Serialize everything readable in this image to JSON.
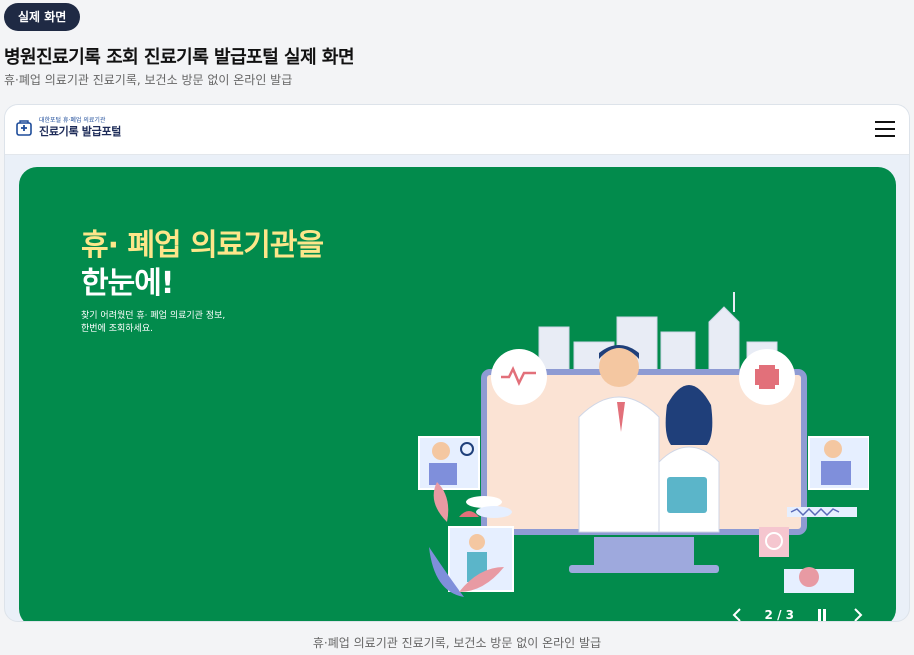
{
  "badge": "실제 화면",
  "title": "병원진료기록 조회 진료기록 발급포털 실제 화면",
  "subtitle": "휴·폐업 의료기관 진료기록, 보건소 방문 없이 온라인 발급",
  "site": {
    "logo_small": "대한포털 휴·폐업 의료기관",
    "logo_big": "진료기록 발급포털",
    "menu_icon": "hamburger-menu-icon"
  },
  "hero": {
    "headline_line1": "휴· 폐업 의료기관을",
    "headline_line2": "한눈에!",
    "desc_line1": "찾기 어려웠던 휴· 폐업 의료기관 정보,",
    "desc_line2": "한번에 조회하세요.",
    "background_color": "#028b4c",
    "headline_color": "#fde68a"
  },
  "carousel": {
    "current": "2",
    "separator": "/",
    "total": "3",
    "prev_icon": "chevron-left-icon",
    "pause_icon": "pause-icon",
    "next_icon": "chevron-right-icon"
  },
  "caption": "휴·폐업 의료기관 진료기록, 보건소 방문 없이 온라인 발급"
}
